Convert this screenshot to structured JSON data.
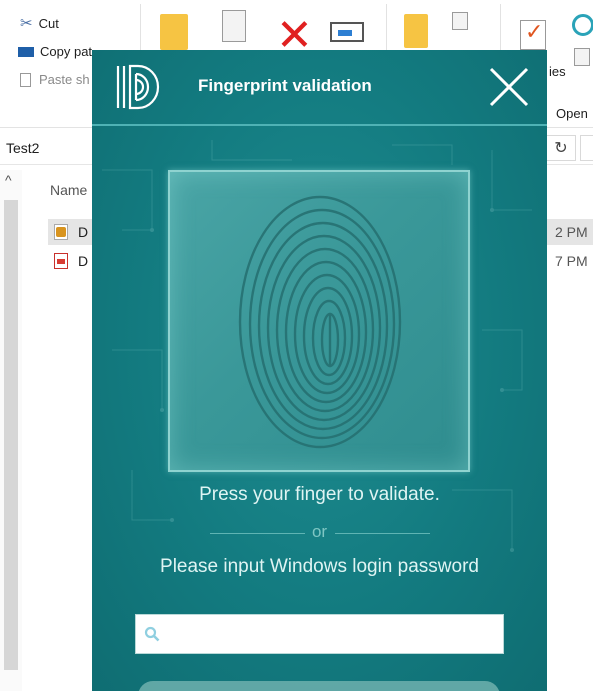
{
  "ribbon": {
    "cut_label": "Cut",
    "copy_path_label": "Copy pat",
    "paste_shortcut_label": "Paste sh",
    "properties_label": "ies",
    "open_label": "Open"
  },
  "address": {
    "path": "Test2",
    "refresh_glyph": "↻"
  },
  "file_list": {
    "header_name": "Name",
    "rows": [
      {
        "name": "D",
        "date": "2 PM",
        "selected": true
      },
      {
        "name": "D",
        "date": "7 PM",
        "selected": false
      }
    ]
  },
  "dialog": {
    "title": "Fingerprint validation",
    "press_instruction": "Press your finger to validate.",
    "or_label": "or",
    "password_instruction": "Please input Windows login password",
    "password_placeholder": "",
    "colors": {
      "background": "#137b80",
      "accent_line": "#4fb2b5",
      "text": "#dff4f3"
    }
  },
  "icons": {
    "logo": "id-fingerprint-logo",
    "close": "close-icon",
    "search": "search-icon",
    "fingerprint": "fingerprint-icon"
  }
}
